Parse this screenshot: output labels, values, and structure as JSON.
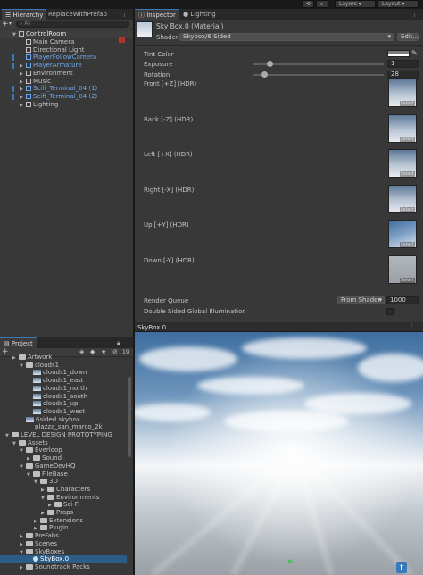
{
  "toolbar": {
    "layers_label": "Layers",
    "layout_label": "Layout"
  },
  "hierarchy": {
    "tab_label": "Hierarchy",
    "tab2_label": "ReplaceWithPrefab",
    "add_label": "+",
    "search_placeholder": "All",
    "root": "ControlRoom",
    "items": [
      {
        "label": "Main Camera",
        "kind": "cube",
        "color": "#c4c4c4",
        "indent": 1
      },
      {
        "label": "Directional Light",
        "kind": "cube",
        "color": "#c4c4c4",
        "indent": 1
      },
      {
        "label": "PlayerFollowCamera",
        "kind": "cube-blue",
        "color": "#6fa8ea",
        "indent": 1
      },
      {
        "label": "PlayerArmature",
        "kind": "cube-blue",
        "color": "#6fa8ea",
        "indent": 1,
        "arrow": true
      },
      {
        "label": "Environment",
        "kind": "cube",
        "color": "#c4c4c4",
        "indent": 1,
        "arrow": true
      },
      {
        "label": "Music",
        "kind": "cube",
        "color": "#c4c4c4",
        "indent": 1,
        "arrow": true
      },
      {
        "label": "Scifi_Terminal_04 (1)",
        "kind": "cube-blue",
        "color": "#6fa8ea",
        "indent": 1,
        "arrow": true
      },
      {
        "label": "Scifi_Terminal_04 (2)",
        "kind": "cube-blue",
        "color": "#6fa8ea",
        "indent": 1,
        "arrow": true
      },
      {
        "label": "Lighting",
        "kind": "cube",
        "color": "#c4c4c4",
        "indent": 1,
        "arrow": true
      }
    ]
  },
  "inspector": {
    "tab_label": "Inspector",
    "tab2_label": "Lighting",
    "material_name": "Sky Box.0 (Material)",
    "shader_label": "Shader",
    "shader_value": "Skybox/6 Sided",
    "edit_label": "Edit...",
    "tint_label": "Tint Color",
    "exposure_label": "Exposure",
    "exposure_value": "1",
    "exposure_level": 0.12,
    "rotation_label": "Rotation",
    "rotation_value": "28",
    "rotation_level": 0.08,
    "faces": [
      {
        "label": "Front [+Z]   (HDR)",
        "select": "Select"
      },
      {
        "label": "Back [-Z]   (HDR)",
        "select": "Select"
      },
      {
        "label": "Left [+X]   (HDR)",
        "select": "Select"
      },
      {
        "label": "Right [-X]   (HDR)",
        "select": "Select"
      },
      {
        "label": "Up [+Y]   (HDR)",
        "select": "Select"
      },
      {
        "label": "Down [-Y]   (HDR)",
        "select": "Select"
      }
    ],
    "render_queue_label": "Render Queue",
    "render_queue_mode": "From Shader",
    "render_queue_value": "1000",
    "double_sided_label": "Double Sided Global Illumination",
    "preview_title": "SkyBox.0"
  },
  "project": {
    "tab_label": "Project",
    "add_label": "+",
    "count": "19",
    "items": [
      {
        "label": "Artwork",
        "kind": "folder",
        "indent": 1
      },
      {
        "label": "clouds1",
        "kind": "folder",
        "indent": 2,
        "open": true
      },
      {
        "label": "clouds1_down",
        "kind": "img",
        "indent": 3
      },
      {
        "label": "clouds1_east",
        "kind": "img",
        "indent": 3
      },
      {
        "label": "clouds1_north",
        "kind": "img",
        "indent": 3
      },
      {
        "label": "clouds1_south",
        "kind": "img",
        "indent": 3
      },
      {
        "label": "clouds1_up",
        "kind": "img",
        "indent": 3
      },
      {
        "label": "clouds1_west",
        "kind": "img",
        "indent": 3
      },
      {
        "label": "6sided skybox",
        "kind": "img",
        "indent": 2
      },
      {
        "label": "plazza_san_marco_2k",
        "kind": "none",
        "indent": 2
      },
      {
        "label": "LEVEL DESIGN PROTOTYPING",
        "kind": "folder",
        "indent": 0,
        "open": true
      },
      {
        "label": "Assets",
        "kind": "folder",
        "indent": 1,
        "open": true
      },
      {
        "label": "Everloop",
        "kind": "folder",
        "indent": 2,
        "open": true
      },
      {
        "label": "Sound",
        "kind": "folder",
        "indent": 3
      },
      {
        "label": "GameDevHQ",
        "kind": "folder",
        "indent": 2,
        "open": true
      },
      {
        "label": "FileBase",
        "kind": "folder",
        "indent": 3,
        "open": true
      },
      {
        "label": "3D",
        "kind": "folder",
        "indent": 4,
        "open": true
      },
      {
        "label": "Characters",
        "kind": "folder",
        "indent": 5
      },
      {
        "label": "Environments",
        "kind": "folder",
        "indent": 5,
        "open": true
      },
      {
        "label": "Sci-Fi",
        "kind": "folder",
        "indent": 6
      },
      {
        "label": "Props",
        "kind": "folder",
        "indent": 5
      },
      {
        "label": "Extensions",
        "kind": "folder",
        "indent": 4
      },
      {
        "label": "Plugin",
        "kind": "folder",
        "indent": 4
      },
      {
        "label": "PreFabs",
        "kind": "folder",
        "indent": 2
      },
      {
        "label": "Scenes",
        "kind": "folder",
        "indent": 2
      },
      {
        "label": "SkyBoxes",
        "kind": "folder",
        "indent": 2,
        "open": true
      },
      {
        "label": "SkyBox.0",
        "kind": "material",
        "indent": 3,
        "selected": true
      },
      {
        "label": "Soundtrack Packs",
        "kind": "folder",
        "indent": 2
      }
    ]
  },
  "colors": {
    "accent": "#3a79bb",
    "selected_row": "#2c5d87",
    "panel": "#383838"
  }
}
